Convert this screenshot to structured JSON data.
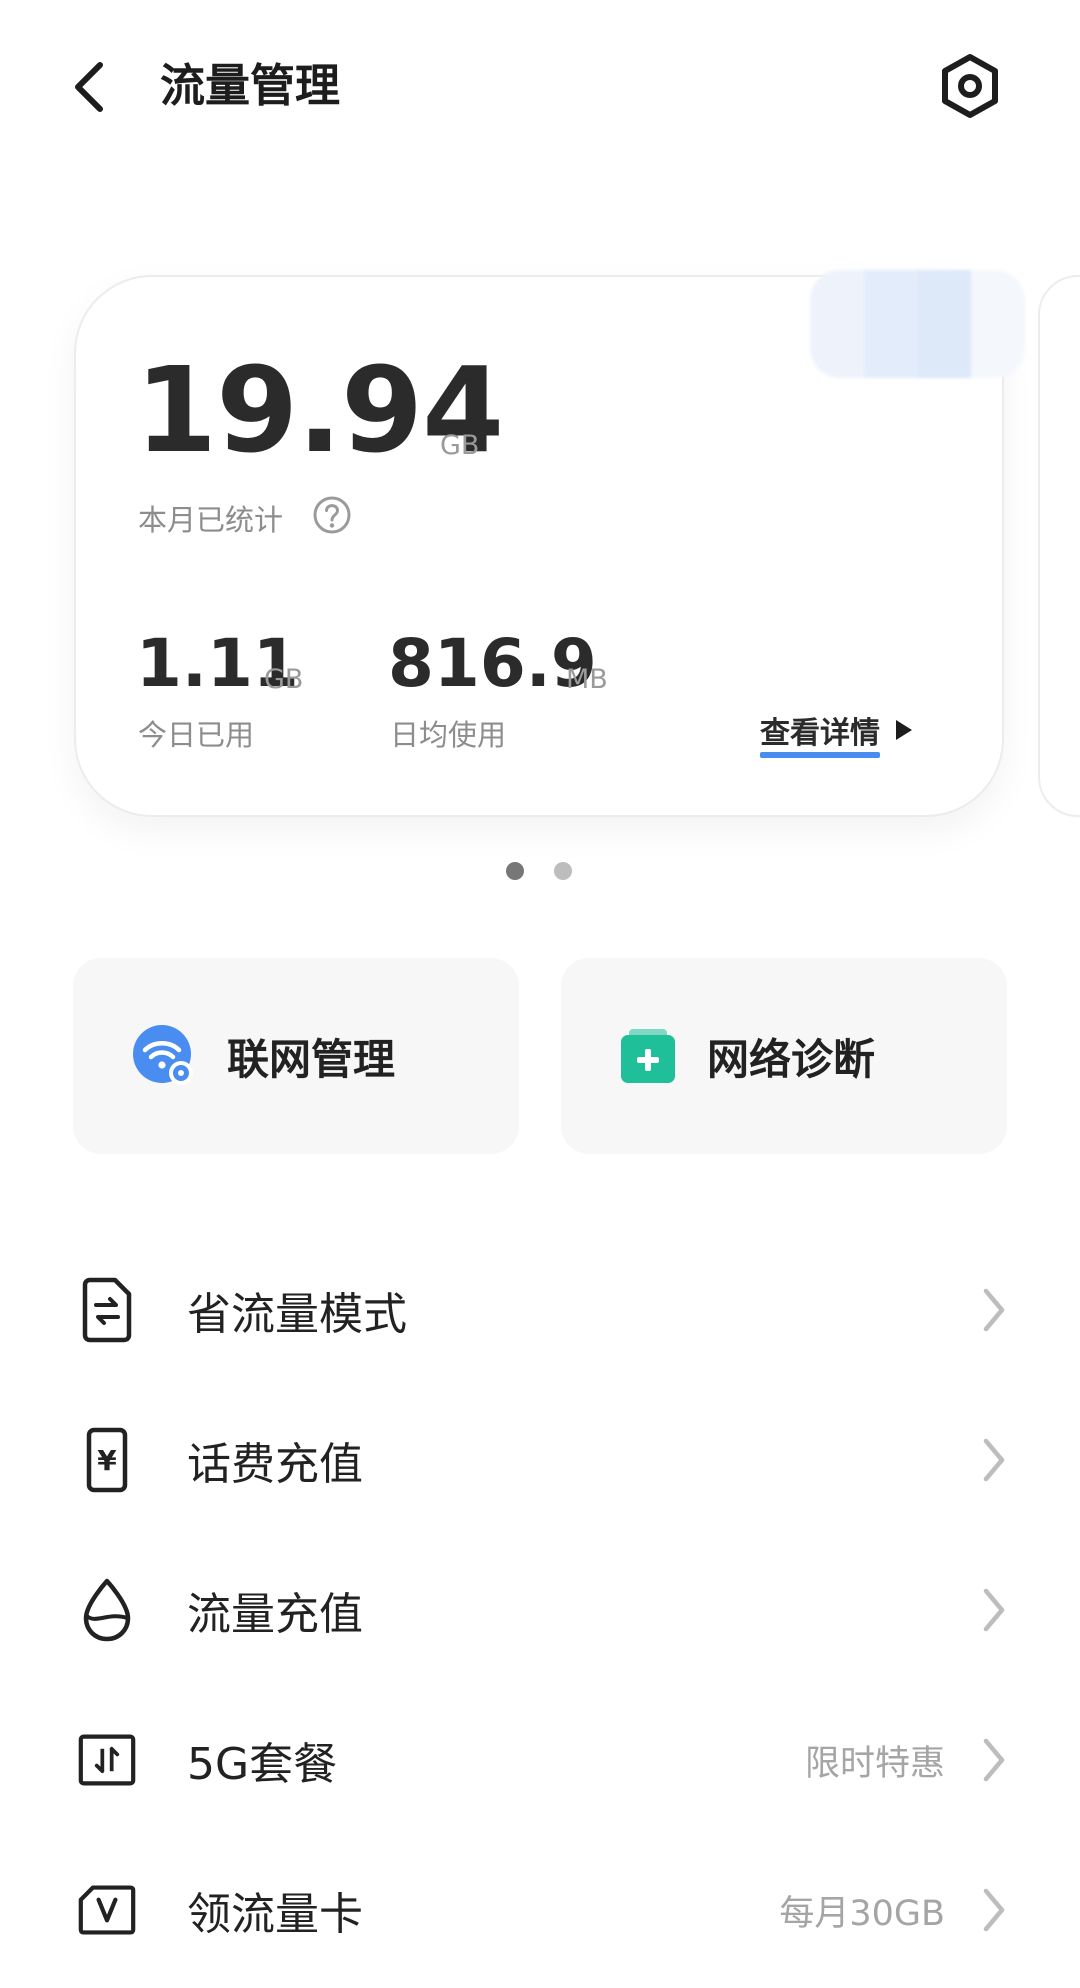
{
  "header": {
    "title": "流量管理",
    "back_icon": "chevron-left-icon",
    "settings_icon": "gear-hexagon-icon"
  },
  "usage_card": {
    "total_value": "19.94",
    "total_unit": "GB",
    "total_label": "本月已统计",
    "today_value": "1.11",
    "today_unit": "GB",
    "today_label": "今日已用",
    "avg_value": "816.9",
    "avg_unit": "MB",
    "avg_label": "日均使用",
    "details_link": "查看详情",
    "page_count": 2,
    "active_page": 1
  },
  "quick_tiles": [
    {
      "label": "联网管理",
      "icon": "wifi-settings-icon",
      "color": "#4a8df0"
    },
    {
      "label": "网络诊断",
      "icon": "medkit-icon",
      "color": "#1fbf9a"
    }
  ],
  "menu": [
    {
      "label": "省流量模式",
      "extra": "",
      "icon": "document-switch-icon"
    },
    {
      "label": "话费充值",
      "extra": "",
      "icon": "yuan-receipt-icon"
    },
    {
      "label": "流量充值",
      "extra": "",
      "icon": "water-drop-icon"
    },
    {
      "label": "5G套餐",
      "extra": "限时特惠",
      "icon": "transfer-square-icon"
    },
    {
      "label": "领流量卡",
      "extra": "每月30GB",
      "icon": "v-card-icon"
    }
  ],
  "colors": {
    "accent_blue": "#4a8df0",
    "accent_green": "#1fbf9a",
    "text_primary": "#222222",
    "text_secondary": "#8d8d8d"
  }
}
